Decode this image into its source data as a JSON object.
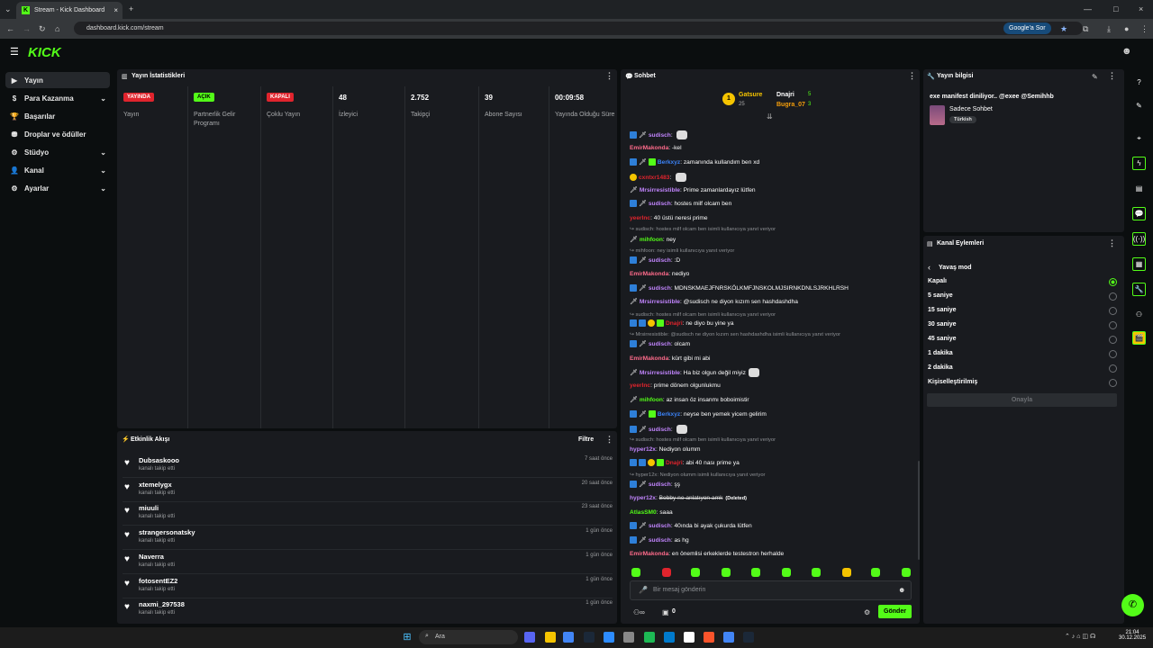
{
  "browser": {
    "tab_title": "Stream - Kick Dashboard",
    "url": "dashboard.kick.com/stream",
    "google_btn": "Google'a Sor"
  },
  "logo": "KICK",
  "sidebar": {
    "items": [
      {
        "label": "Yayın",
        "icon": "camera-icon",
        "active": true,
        "chevron": false
      },
      {
        "label": "Para Kazanma",
        "icon": "money-icon",
        "chevron": true
      },
      {
        "label": "Başarılar",
        "icon": "trophy-icon",
        "chevron": false
      },
      {
        "label": "Droplar ve ödüller",
        "icon": "gift-icon",
        "chevron": false
      },
      {
        "label": "Stüdyo",
        "icon": "gear-icon",
        "chevron": true
      },
      {
        "label": "Kanal",
        "icon": "user-icon",
        "chevron": true
      },
      {
        "label": "Ayarlar",
        "icon": "settings-icon",
        "chevron": true
      }
    ]
  },
  "stats": {
    "title": "Yayın İstatistikleri",
    "cols": [
      {
        "badge": "YAYINDA",
        "badge_color": "#e0242d",
        "label": "Yayın"
      },
      {
        "badge": "AÇIK",
        "badge_color": "#53fc18",
        "label": "Partnerlik Gelir Programı"
      },
      {
        "badge": "KAPALI",
        "badge_color": "#e0242d",
        "label": "Çoklu Yayın"
      },
      {
        "value": "48",
        "label": "İzleyici"
      },
      {
        "value": "2.752",
        "label": "Takipçi"
      },
      {
        "value": "39",
        "label": "Abone Sayısı"
      },
      {
        "value": "00:09:58",
        "label": "Yayında Olduğu Süre"
      }
    ]
  },
  "activity": {
    "title": "Etkinlik Akışı",
    "filter": "Filtre",
    "items": [
      {
        "name": "Dubsaskooo",
        "sub": "kanalı takip etti",
        "time": "7 saat önce"
      },
      {
        "name": "xtemelygx",
        "sub": "kanalı takip etti",
        "time": "20 saat önce"
      },
      {
        "name": "miuuli",
        "sub": "kanalı takip etti",
        "time": "23 saat önce"
      },
      {
        "name": "strangersonatsky",
        "sub": "kanalı takip etti",
        "time": "1 gün önce"
      },
      {
        "name": "Naverra",
        "sub": "kanalı takip etti",
        "time": "1 gün önce"
      },
      {
        "name": "fotosentEZ2",
        "sub": "kanalı takip etti",
        "time": "1 gün önce"
      },
      {
        "name": "naxmi_297538",
        "sub": "kanalı takip etti",
        "time": "1 gün önce"
      }
    ]
  },
  "chat": {
    "title": "Sohbet",
    "leader1": {
      "rank": "1",
      "name": "Gatsure",
      "count": "25"
    },
    "leader2": {
      "name": "Dnajri",
      "count": "5"
    },
    "leader3": {
      "name": "Bugra_07",
      "count": "3"
    },
    "messages": [
      {
        "user": "sudisch",
        "color": "#c084fc",
        "text": "",
        "badges": [
          "b",
          "m"
        ],
        "emote": true
      },
      {
        "user": "EmirMakonda",
        "color": "#ff6b8b",
        "text": "-kel",
        "badges": []
      },
      {
        "user": "Berkxyz",
        "color": "#3b82f6",
        "text": "zamanında kullandım ben xd",
        "badges": [
          "b",
          "m",
          "g"
        ]
      },
      {
        "user": "cxntxr1483",
        "color": "#e0242d",
        "text": "",
        "badges": [
          "y"
        ],
        "emote": true
      },
      {
        "user": "Mrsirresistible",
        "color": "#c084fc",
        "text": "Prime zamanlardayız lütfen",
        "badges": [
          "m"
        ]
      },
      {
        "user": "sudisch",
        "color": "#c084fc",
        "text": "hostes milf olcam ben",
        "badges": [
          "b",
          "m"
        ]
      },
      {
        "user": "yeerlnc",
        "color": "#e0242d",
        "text": "40 üstü neresi prime",
        "badges": []
      },
      {
        "reply": "sudisch: hostes milf olcam ben isimli kullanıcıya yanıt veriyor"
      },
      {
        "user": "mihfoon",
        "color": "#53fc18",
        "text": "ney",
        "badges": [
          "m"
        ]
      },
      {
        "reply": "mihfoon: ney isimli kullanıcıya yanıt veriyor"
      },
      {
        "user": "sudisch",
        "color": "#c084fc",
        "text": ":D",
        "badges": [
          "b",
          "m"
        ]
      },
      {
        "user": "EmirMakonda",
        "color": "#ff6b8b",
        "text": "nediyo",
        "badges": []
      },
      {
        "user": "sudisch",
        "color": "#c084fc",
        "text": "MDNSKMAEJFNRSKÖLKMFJNSKOLMJSIRNKDNLSJRKHLRSH",
        "badges": [
          "b",
          "m"
        ]
      },
      {
        "user": "Mrsirresistible",
        "color": "#c084fc",
        "text": "@sudisch ne diyon kızım sen hashdashdha",
        "badges": [
          "m"
        ]
      },
      {
        "reply": "sudisch: hostes milf olcam ben isimli kullanıcıya yanıt veriyor"
      },
      {
        "user": "Dnajri",
        "color": "#e0242d",
        "text": "ne diyo bu yine ya",
        "badges": [
          "b",
          "b",
          "y",
          "g"
        ]
      },
      {
        "reply": "Mrsirresistible: @sudisch ne diyon kızım sen hashdashdha isimli kullanıcıya yanıt veriyor"
      },
      {
        "user": "sudisch",
        "color": "#c084fc",
        "text": "olcam",
        "badges": [
          "b",
          "m"
        ]
      },
      {
        "user": "EmirMakonda",
        "color": "#ff6b8b",
        "text": "kürt gibi mi abi",
        "badges": []
      },
      {
        "user": "Mrsirresistible",
        "color": "#c084fc",
        "text": "Ha biz olgun değil miyiz",
        "badges": [
          "m"
        ],
        "emote": true
      },
      {
        "user": "yeerlnc",
        "color": "#e0242d",
        "text": "prime dönem olgunlukmu",
        "badges": []
      },
      {
        "user": "mihfoon",
        "color": "#53fc18",
        "text": "az insan öz insanmı boboimistir",
        "badges": [
          "m"
        ]
      },
      {
        "user": "Berkxyz",
        "color": "#3b82f6",
        "text": "neyse ben yemek yicem gelirim",
        "badges": [
          "b",
          "m",
          "g"
        ]
      },
      {
        "user": "sudisch",
        "color": "#c084fc",
        "text": "",
        "badges": [
          "b",
          "m"
        ],
        "emote": true
      },
      {
        "reply": "sudisch: hostes milf olcam ben isimli kullanıcıya yanıt veriyor"
      },
      {
        "user": "hyper12x",
        "color": "#c084fc",
        "text": "Nediyon olumm",
        "badges": []
      },
      {
        "user": "Dnajri",
        "color": "#e0242d",
        "text": "abi 40 nası prime ya",
        "badges": [
          "b",
          "b",
          "y",
          "g"
        ]
      },
      {
        "reply": "hyper12x: Nediyon olumm isimli kullanıcıya yanıt veriyor"
      },
      {
        "user": "sudisch",
        "color": "#c084fc",
        "text": "şş",
        "badges": [
          "b",
          "m"
        ]
      },
      {
        "user": "hyper12x",
        "color": "#c084fc",
        "text": "Bobby ne anlatıyon amk",
        "badges": [],
        "deleted": "(Deleted)"
      },
      {
        "user": "AtlasSM0",
        "color": "#53fc18",
        "text": "saaa",
        "badges": []
      },
      {
        "user": "sudisch",
        "color": "#c084fc",
        "text": "40ında bi ayak çukurda lütfen",
        "badges": [
          "b",
          "m"
        ]
      },
      {
        "user": "sudisch",
        "color": "#c084fc",
        "text": "as hg",
        "badges": [
          "b",
          "m"
        ]
      },
      {
        "user": "EmirMakonda",
        "color": "#ff6b8b",
        "text": "en önemlisi erkeklerde testestron herhalde",
        "badges": []
      }
    ],
    "input_placeholder": "Bir mesaj gönderin",
    "send": "Gönder",
    "points": "0"
  },
  "stream_info": {
    "title": "Yayın bilgisi",
    "stream_title": "exe manifest diniliyor.. @exee @Semihhb",
    "category": "Sadece Sohbet",
    "language": "Türkish"
  },
  "channel_actions": {
    "title": "Kanal Eylemleri",
    "back": "Yavaş mod",
    "options": [
      "Kapalı",
      "5 saniye",
      "15 saniye",
      "30 saniye",
      "45 saniye",
      "1 dakika",
      "2 dakika",
      "Kişiselleştirilmiş"
    ],
    "selected": 0,
    "confirm": "Onayla"
  },
  "taskbar": {
    "search": "Ara",
    "time": "21:04",
    "date": "30.12.2025"
  }
}
